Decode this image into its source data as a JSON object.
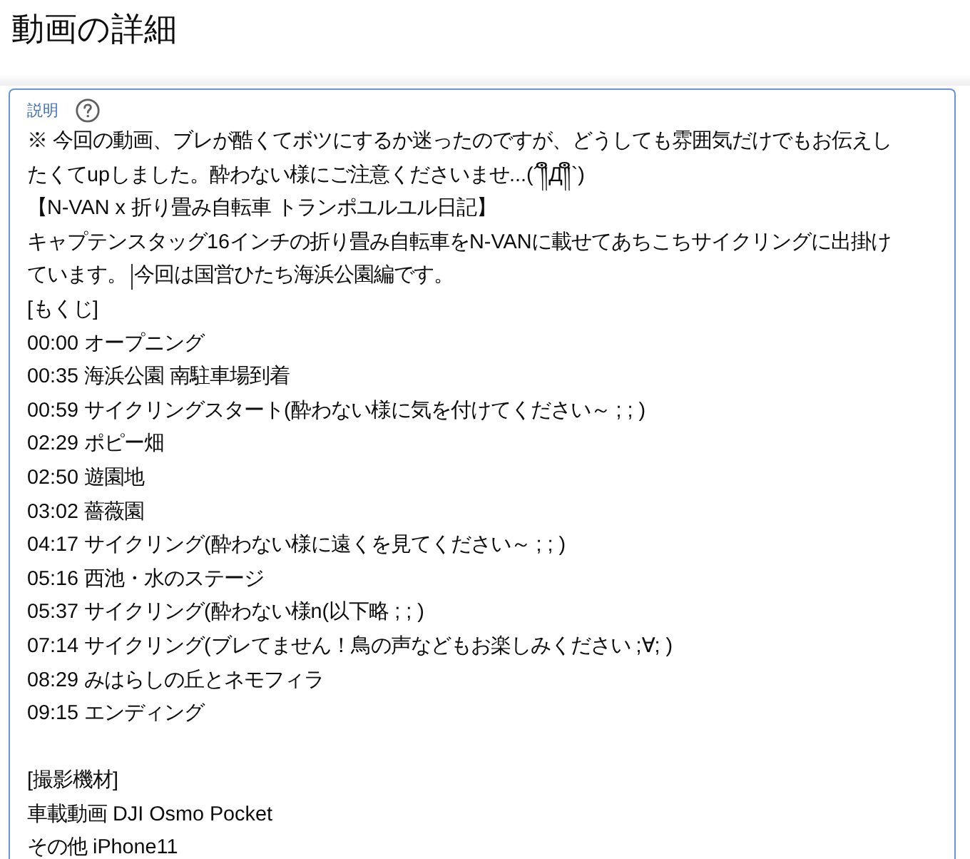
{
  "title": "動画の詳細",
  "description": {
    "label": "説明",
    "focused": true,
    "blocks": [
      {
        "lines": [
          {
            "text": "※ 今回の動画、ブレが酷くてボツにするか迷ったのですが、どうしても雰囲気だけでもお伝えし"
          },
          {
            "text": "たくてupしました。酔わない様にご注意くださいませ...(´༎ຶД༎ຶ`)"
          },
          {
            "text": "【N-VAN x 折り畳み自転車 トランポユルユル日記】"
          },
          {
            "text": "キャプテンスタッグ16インチの折り畳み自転車をN-VANに載せてあちこちサイクリングに出掛け"
          },
          {
            "text": "ています。",
            "after_caret": "今回は国営ひたち海浜公園編です。"
          },
          {
            "text": "[もくじ]"
          },
          {
            "text": "00:00 オープニング"
          },
          {
            "text": "00:35 海浜公園 南駐車場到着"
          },
          {
            "text": "00:59 サイクリングスタート(酔わない様に気を付けてください～ ; ; )"
          },
          {
            "text": "02:29 ポピー畑"
          },
          {
            "text": "02:50 遊園地"
          },
          {
            "text": "03:02 薔薇園"
          },
          {
            "text": "04:17 サイクリング(酔わない様に遠くを見てください～ ; ; )"
          },
          {
            "text": "05:16 西池・水のステージ"
          },
          {
            "text": "05:37 サイクリング(酔わない様n(以下略 ; ; )"
          },
          {
            "text": "07:14 サイクリング(ブレてません！鳥の声などもお楽しみください ;∀; )"
          },
          {
            "text": "08:29 みはらしの丘とネモフィラ"
          },
          {
            "text": "09:15 エンディング"
          }
        ]
      },
      {
        "lines": [
          {
            "text": "[撮影機材]"
          },
          {
            "text": "車載動画 DJI Osmo Pocket"
          },
          {
            "text": "その他 iPhone11"
          }
        ]
      }
    ]
  }
}
